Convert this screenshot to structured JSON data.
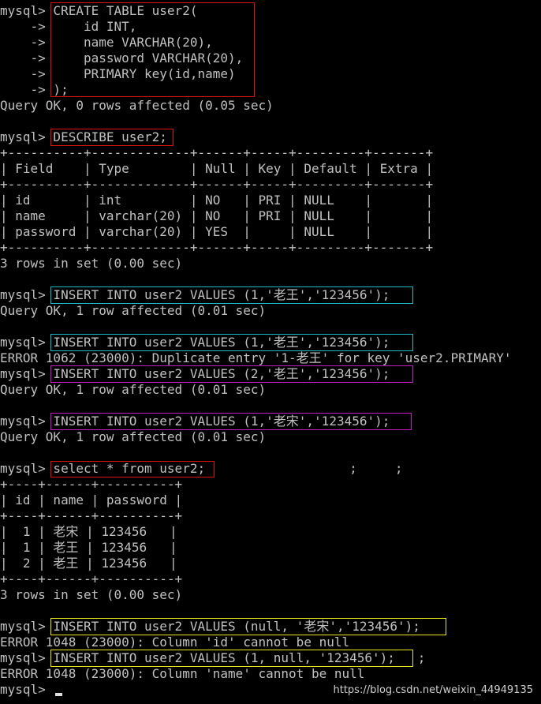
{
  "console": {
    "lines": [
      "mysql> CREATE TABLE user2(",
      "    ->     id INT,",
      "    ->     name VARCHAR(20),",
      "    ->     password VARCHAR(20),",
      "    ->     PRIMARY key(id,name)",
      "    -> );",
      "Query OK, 0 rows affected (0.05 sec)",
      "",
      "mysql> DESCRIBE user2;",
      "+----------+-------------+------+-----+---------+-------+",
      "| Field    | Type        | Null | Key | Default | Extra |",
      "+----------+-------------+------+-----+---------+-------+",
      "| id       | int         | NO   | PRI | NULL    |       |",
      "| name     | varchar(20) | NO   | PRI | NULL    |       |",
      "| password | varchar(20) | YES  |     | NULL    |       |",
      "+----------+-------------+------+-----+---------+-------+",
      "3 rows in set (0.00 sec)",
      "",
      "mysql> INSERT INTO user2 VALUES (1,'老王','123456');",
      "Query OK, 1 row affected (0.01 sec)",
      "",
      "mysql> INSERT INTO user2 VALUES (1,'老王','123456');",
      "ERROR 1062 (23000): Duplicate entry '1-老王' for key 'user2.PRIMARY'",
      "mysql> INSERT INTO user2 VALUES (2,'老王','123456');",
      "Query OK, 1 row affected (0.01 sec)",
      "",
      "mysql> INSERT INTO user2 VALUES (1,'老宋','123456');",
      "Query OK, 1 row affected (0.01 sec)",
      "",
      "mysql> select * from user2;                   ;     ;",
      "+----+------+----------+",
      "| id | name | password |",
      "+----+------+----------+",
      "|  1 | 老宋 | 123456   |",
      "|  1 | 老王 | 123456   |",
      "|  2 | 老王 | 123456   |",
      "+----+------+----------+",
      "3 rows in set (0.00 sec)",
      "",
      "mysql> INSERT INTO user2 VALUES (null, '老宋','123456');",
      "ERROR 1048 (23000): Column 'id' cannot be null",
      "mysql> INSERT INTO user2 VALUES (1, null, '123456');   ;",
      "ERROR 1048 (23000): Column 'name' cannot be null",
      "mysql> "
    ]
  },
  "watermark": "https://blog.csdn.net/weixin_44949135",
  "colors": {
    "background": "#000000",
    "text": "#c0c0c0",
    "box_red": "#e01010",
    "box_cyan": "#1fb9c6",
    "box_magenta": "#c51bc5",
    "box_yellow": "#e6e61a"
  }
}
